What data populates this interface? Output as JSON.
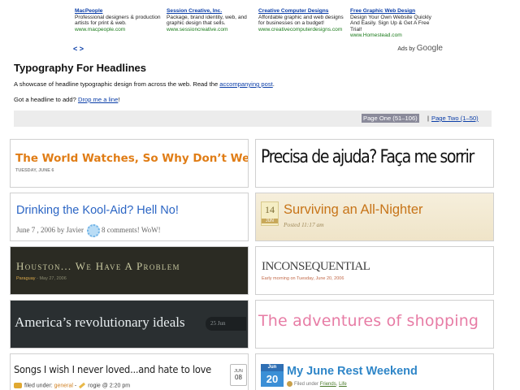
{
  "ads": {
    "items": [
      {
        "title": "MacPeople",
        "desc": "Professional designers & production artists for print & web.",
        "url": "www.macpeople.com"
      },
      {
        "title": "Session Creative, Inc.",
        "desc": "Package, brand identity, web, and graphic design that sells.",
        "url": "www.sessioncreative.com"
      },
      {
        "title": "Creative Computer Designs",
        "desc": "Affordable graphic and web designs for businesses on a budget!",
        "url": "www.creativecomputerdesigns.com"
      },
      {
        "title": "Free Graphic Web Design",
        "desc": "Design Your Own Website Quickly And Easily. Sign Up & Get A Free Trial!",
        "url": "www.Homestead.com"
      }
    ],
    "nav": "< >",
    "ads_by": "Ads by",
    "google": "Google"
  },
  "page": {
    "title": "Typography For Headlines",
    "intro_text": "A showcase of headline typographic design from across the web. Read the",
    "intro_link": "accompanying post",
    "intro_end": ".",
    "submit_text": "Got a headline to add?",
    "submit_link": "Drop me a line",
    "submit_end": "!"
  },
  "pager": {
    "current": "Page One (51–106)",
    "separator": "|",
    "next": "Page Two (1–50)"
  },
  "cards": [
    {
      "headline": "The World Watches, So Why Don’t We?",
      "meta": "TUESDAY, JUNE 6"
    },
    {
      "headline": "Precisa de ajuda? Faça me sorrir"
    },
    {
      "headline": "Drinking the Kool-Aid? Hell No!",
      "meta": "June 7 , 2006 by Javier",
      "comments": "8 comments! WoW!"
    },
    {
      "headline": "Surviving an All-Nighter",
      "meta": "Posted 11:17 am",
      "cal_day": "14",
      "cal_month": "JUN"
    },
    {
      "headline": "Houston... We Have A Problem",
      "meta_tag": "Paraguay",
      "meta": "- May 27, 2006"
    },
    {
      "headline": "INCONSEQUENTIAL",
      "meta": "Early morning on Tuesday, June 20, 2006"
    },
    {
      "headline": "America’s revolutionary ideals",
      "badge": "25 Jun"
    },
    {
      "headline": "The adventures of shopping"
    },
    {
      "headline": "Songs I wish I never loved...and hate to love",
      "filed": "filed under:",
      "category": "general",
      "dash": "-",
      "author": "rogie @ 2:20 pm",
      "cal_month": "JUN",
      "cal_day": "08"
    },
    {
      "headline": "My June Rest Weekend",
      "cal_month": "Jun",
      "cal_day": "20",
      "filed": "Filed under",
      "cat1": "Friends",
      "comma": ",",
      "cat2": "Life"
    }
  ]
}
